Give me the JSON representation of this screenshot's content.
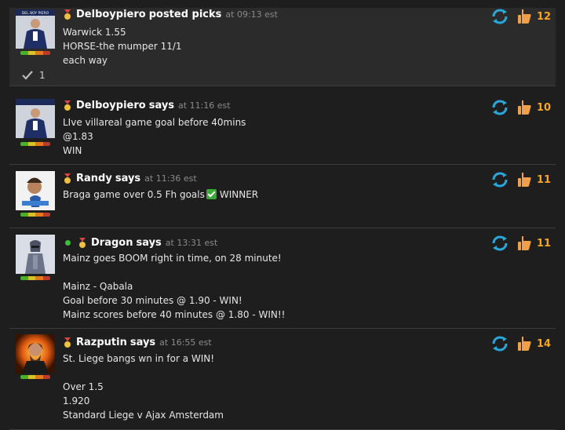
{
  "posts": [
    {
      "author": "Delboypiero",
      "verb": "posted picks",
      "at": "at 09:13 est",
      "lines": [
        "Warwick 1.55",
        "HORSE-the mumper 11/1",
        "each way"
      ],
      "like_count": "12",
      "likes_badge": "1",
      "avatar_caption": "DEL BOY PIERO"
    },
    {
      "author": "Delboypiero",
      "verb": "says",
      "at": "at 11:16 est",
      "lines": [
        "LIve villareal game goal before 40mins",
        "@1.83",
        "WIN"
      ],
      "like_count": "10"
    },
    {
      "author": "Randy",
      "verb": "says",
      "at": "at 11:36 est",
      "line_before_check": "Braga game over 0.5 Fh goals",
      "line_after_check": "WINNER",
      "like_count": "11"
    },
    {
      "author": "Dragon",
      "verb": "says",
      "at": "at 13:31 est",
      "lines": [
        "Mainz goes BOOM right in time, on 28 minute!",
        "",
        "Mainz - Qabala",
        "Goal before 30 minutes @ 1.90 - WIN!",
        "Mainz scores before 40 minutes @ 1.80 - WIN!!"
      ],
      "like_count": "11"
    },
    {
      "author": "Razputin",
      "verb": "says",
      "at": "at 16:55 est",
      "lines": [
        "St. Liege bangs wn in for a WIN!",
        "",
        "Over 1.5",
        "1.920",
        "Standard Liege v Ajax Amsterdam"
      ],
      "like_count": "14"
    }
  ],
  "icons": {
    "medal": "medal-icon",
    "refresh": "refresh-icon",
    "like": "thumbs-up-icon",
    "check": "check-icon",
    "online": "online-indicator"
  },
  "colors": {
    "background": "#1e1e1e",
    "highlight_row": "#2b2b2b",
    "like_count": "#f5a623",
    "refresh": "#2aa7d8",
    "thumb": "#f0a04b",
    "online": "#35c235"
  }
}
